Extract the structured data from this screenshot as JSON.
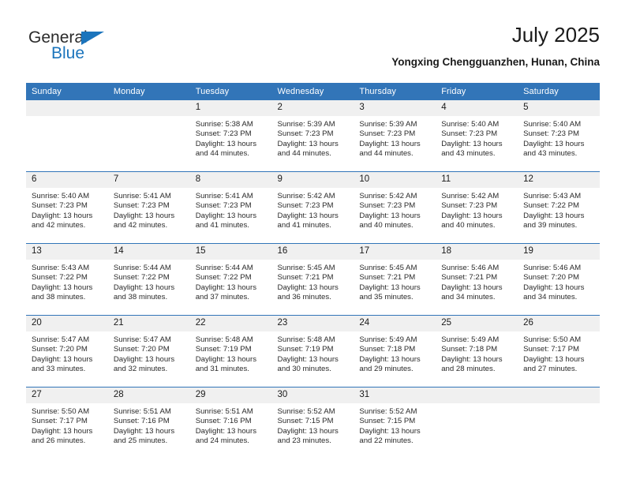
{
  "brand": {
    "name_top": "General",
    "name_bottom": "Blue",
    "flag_icon": "flag-triangle-icon",
    "color_top": "#2b2b2b",
    "color_bottom": "#1b74bc"
  },
  "header": {
    "title": "July 2025",
    "subtitle": "Yongxing Chengguanzhen, Hunan, China"
  },
  "theme": {
    "header_blue": "#3275b8",
    "daynum_background": "#f0f0f0",
    "text": "#2a2a2a"
  },
  "weekday_headers": [
    "Sunday",
    "Monday",
    "Tuesday",
    "Wednesday",
    "Thursday",
    "Friday",
    "Saturday"
  ],
  "weeks": [
    [
      {
        "day": "",
        "sunrise": "",
        "sunset": "",
        "daylight": "",
        "daylight2": ""
      },
      {
        "day": "",
        "sunrise": "",
        "sunset": "",
        "daylight": "",
        "daylight2": ""
      },
      {
        "day": "1",
        "sunrise": "Sunrise: 5:38 AM",
        "sunset": "Sunset: 7:23 PM",
        "daylight": "Daylight: 13 hours",
        "daylight2": "and 44 minutes."
      },
      {
        "day": "2",
        "sunrise": "Sunrise: 5:39 AM",
        "sunset": "Sunset: 7:23 PM",
        "daylight": "Daylight: 13 hours",
        "daylight2": "and 44 minutes."
      },
      {
        "day": "3",
        "sunrise": "Sunrise: 5:39 AM",
        "sunset": "Sunset: 7:23 PM",
        "daylight": "Daylight: 13 hours",
        "daylight2": "and 44 minutes."
      },
      {
        "day": "4",
        "sunrise": "Sunrise: 5:40 AM",
        "sunset": "Sunset: 7:23 PM",
        "daylight": "Daylight: 13 hours",
        "daylight2": "and 43 minutes."
      },
      {
        "day": "5",
        "sunrise": "Sunrise: 5:40 AM",
        "sunset": "Sunset: 7:23 PM",
        "daylight": "Daylight: 13 hours",
        "daylight2": "and 43 minutes."
      }
    ],
    [
      {
        "day": "6",
        "sunrise": "Sunrise: 5:40 AM",
        "sunset": "Sunset: 7:23 PM",
        "daylight": "Daylight: 13 hours",
        "daylight2": "and 42 minutes."
      },
      {
        "day": "7",
        "sunrise": "Sunrise: 5:41 AM",
        "sunset": "Sunset: 7:23 PM",
        "daylight": "Daylight: 13 hours",
        "daylight2": "and 42 minutes."
      },
      {
        "day": "8",
        "sunrise": "Sunrise: 5:41 AM",
        "sunset": "Sunset: 7:23 PM",
        "daylight": "Daylight: 13 hours",
        "daylight2": "and 41 minutes."
      },
      {
        "day": "9",
        "sunrise": "Sunrise: 5:42 AM",
        "sunset": "Sunset: 7:23 PM",
        "daylight": "Daylight: 13 hours",
        "daylight2": "and 41 minutes."
      },
      {
        "day": "10",
        "sunrise": "Sunrise: 5:42 AM",
        "sunset": "Sunset: 7:23 PM",
        "daylight": "Daylight: 13 hours",
        "daylight2": "and 40 minutes."
      },
      {
        "day": "11",
        "sunrise": "Sunrise: 5:42 AM",
        "sunset": "Sunset: 7:23 PM",
        "daylight": "Daylight: 13 hours",
        "daylight2": "and 40 minutes."
      },
      {
        "day": "12",
        "sunrise": "Sunrise: 5:43 AM",
        "sunset": "Sunset: 7:22 PM",
        "daylight": "Daylight: 13 hours",
        "daylight2": "and 39 minutes."
      }
    ],
    [
      {
        "day": "13",
        "sunrise": "Sunrise: 5:43 AM",
        "sunset": "Sunset: 7:22 PM",
        "daylight": "Daylight: 13 hours",
        "daylight2": "and 38 minutes."
      },
      {
        "day": "14",
        "sunrise": "Sunrise: 5:44 AM",
        "sunset": "Sunset: 7:22 PM",
        "daylight": "Daylight: 13 hours",
        "daylight2": "and 38 minutes."
      },
      {
        "day": "15",
        "sunrise": "Sunrise: 5:44 AM",
        "sunset": "Sunset: 7:22 PM",
        "daylight": "Daylight: 13 hours",
        "daylight2": "and 37 minutes."
      },
      {
        "day": "16",
        "sunrise": "Sunrise: 5:45 AM",
        "sunset": "Sunset: 7:21 PM",
        "daylight": "Daylight: 13 hours",
        "daylight2": "and 36 minutes."
      },
      {
        "day": "17",
        "sunrise": "Sunrise: 5:45 AM",
        "sunset": "Sunset: 7:21 PM",
        "daylight": "Daylight: 13 hours",
        "daylight2": "and 35 minutes."
      },
      {
        "day": "18",
        "sunrise": "Sunrise: 5:46 AM",
        "sunset": "Sunset: 7:21 PM",
        "daylight": "Daylight: 13 hours",
        "daylight2": "and 34 minutes."
      },
      {
        "day": "19",
        "sunrise": "Sunrise: 5:46 AM",
        "sunset": "Sunset: 7:20 PM",
        "daylight": "Daylight: 13 hours",
        "daylight2": "and 34 minutes."
      }
    ],
    [
      {
        "day": "20",
        "sunrise": "Sunrise: 5:47 AM",
        "sunset": "Sunset: 7:20 PM",
        "daylight": "Daylight: 13 hours",
        "daylight2": "and 33 minutes."
      },
      {
        "day": "21",
        "sunrise": "Sunrise: 5:47 AM",
        "sunset": "Sunset: 7:20 PM",
        "daylight": "Daylight: 13 hours",
        "daylight2": "and 32 minutes."
      },
      {
        "day": "22",
        "sunrise": "Sunrise: 5:48 AM",
        "sunset": "Sunset: 7:19 PM",
        "daylight": "Daylight: 13 hours",
        "daylight2": "and 31 minutes."
      },
      {
        "day": "23",
        "sunrise": "Sunrise: 5:48 AM",
        "sunset": "Sunset: 7:19 PM",
        "daylight": "Daylight: 13 hours",
        "daylight2": "and 30 minutes."
      },
      {
        "day": "24",
        "sunrise": "Sunrise: 5:49 AM",
        "sunset": "Sunset: 7:18 PM",
        "daylight": "Daylight: 13 hours",
        "daylight2": "and 29 minutes."
      },
      {
        "day": "25",
        "sunrise": "Sunrise: 5:49 AM",
        "sunset": "Sunset: 7:18 PM",
        "daylight": "Daylight: 13 hours",
        "daylight2": "and 28 minutes."
      },
      {
        "day": "26",
        "sunrise": "Sunrise: 5:50 AM",
        "sunset": "Sunset: 7:17 PM",
        "daylight": "Daylight: 13 hours",
        "daylight2": "and 27 minutes."
      }
    ],
    [
      {
        "day": "27",
        "sunrise": "Sunrise: 5:50 AM",
        "sunset": "Sunset: 7:17 PM",
        "daylight": "Daylight: 13 hours",
        "daylight2": "and 26 minutes."
      },
      {
        "day": "28",
        "sunrise": "Sunrise: 5:51 AM",
        "sunset": "Sunset: 7:16 PM",
        "daylight": "Daylight: 13 hours",
        "daylight2": "and 25 minutes."
      },
      {
        "day": "29",
        "sunrise": "Sunrise: 5:51 AM",
        "sunset": "Sunset: 7:16 PM",
        "daylight": "Daylight: 13 hours",
        "daylight2": "and 24 minutes."
      },
      {
        "day": "30",
        "sunrise": "Sunrise: 5:52 AM",
        "sunset": "Sunset: 7:15 PM",
        "daylight": "Daylight: 13 hours",
        "daylight2": "and 23 minutes."
      },
      {
        "day": "31",
        "sunrise": "Sunrise: 5:52 AM",
        "sunset": "Sunset: 7:15 PM",
        "daylight": "Daylight: 13 hours",
        "daylight2": "and 22 minutes."
      },
      {
        "day": "",
        "sunrise": "",
        "sunset": "",
        "daylight": "",
        "daylight2": ""
      },
      {
        "day": "",
        "sunrise": "",
        "sunset": "",
        "daylight": "",
        "daylight2": ""
      }
    ]
  ]
}
